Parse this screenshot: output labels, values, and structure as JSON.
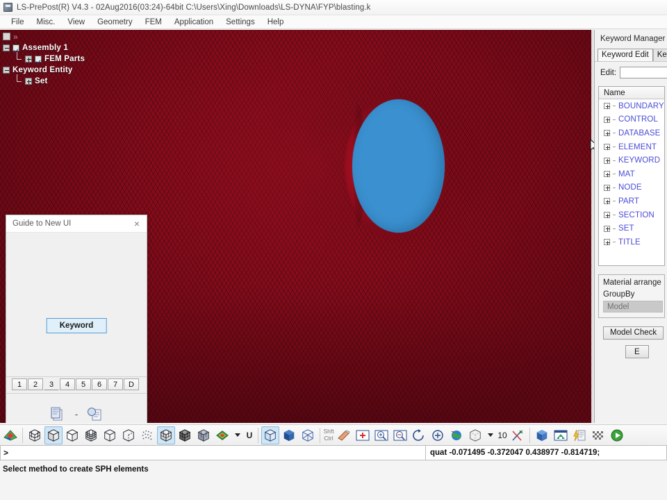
{
  "window": {
    "title": "LS-PrePost(R) V4.3 - 02Aug2016(03:24)-64bit C:\\Users\\Xing\\Downloads\\LS-DYNA\\FYP\\blasting.k",
    "app_icon": "app-icon"
  },
  "menu": {
    "items": [
      "File",
      "Misc.",
      "View",
      "Geometry",
      "FEM",
      "Application",
      "Settings",
      "Help"
    ]
  },
  "tree": {
    "nodes": [
      {
        "label": "Assembly 1",
        "expander": "minus",
        "checkbox": true,
        "indent": 0
      },
      {
        "label": "FEM Parts",
        "expander": "plus",
        "checkbox": true,
        "indent": 1
      },
      {
        "label": "Keyword Entity",
        "expander": "minus",
        "checkbox": false,
        "indent": 0
      },
      {
        "label": "Set",
        "expander": "plus",
        "checkbox": false,
        "indent": 1
      }
    ]
  },
  "guide": {
    "title": "Guide to New UI",
    "close_label": "×",
    "keyword_button": "Keyword",
    "pages": [
      "1",
      "2",
      "3",
      "4",
      "5",
      "6",
      "7",
      "D"
    ],
    "active_page": "3",
    "footer_separator": "-"
  },
  "keyword_manager": {
    "title": "Keyword Manager",
    "tabs": [
      {
        "label": "Keyword Edit",
        "active": true
      },
      {
        "label": "Key",
        "active": false
      }
    ],
    "edit_label": "Edit:",
    "edit_value": "",
    "edit_placeholder": "",
    "name_column_header": "Name",
    "keywords": [
      "BOUNDARY",
      "CONTROL",
      "DATABASE",
      "ELEMENT",
      "KEYWORD",
      "MAT",
      "NODE",
      "PART",
      "SECTION",
      "SET",
      "TITLE"
    ],
    "material_arrange_label": "Material arrange",
    "groupby_label": "GroupBy",
    "groupby_value": "Model",
    "model_check_button": "Model Check",
    "clipped_button": "E"
  },
  "toolbar": {
    "zoom_value": "10",
    "fringe_label": "U",
    "shift_label": "Shft",
    "ctrl_label": "Ctrl",
    "icons": [
      "contour-fringe-icon",
      "mesh-wireframe-icon",
      "shaded-cube-icon",
      "smooth-shade-icon",
      "mesh-grid-icon",
      "hidden-line-icon",
      "feature-line-icon",
      "particle-dots-icon",
      "shaded-mesh-icon",
      "shaded-edges-icon",
      "transparent-cube-icon",
      "color-fringe-icon",
      "solid-cube-icon",
      "filled-cube-icon",
      "wireframe-box-icon",
      "hand-pan-icon",
      "zoom-window-icon",
      "zoom-in-icon",
      "zoom-area-icon",
      "rotate-icon",
      "reset-view-icon",
      "globe-icon",
      "bounding-box-icon",
      "axis-scissors-icon",
      "part-cube-icon",
      "home-view-icon",
      "lightning-page-icon",
      "checker-icon",
      "play-button-icon"
    ]
  },
  "command": {
    "prompt": ">",
    "value": "",
    "quaternion": "quat -0.071495 -0.372047 0.438977 -0.814719;"
  },
  "status": {
    "message": "Select method to create SPH elements"
  },
  "colors": {
    "mesh_red": "#8b0d1c",
    "sphere_blue": "#3b90cf",
    "keyword_text": "#4b4bd8",
    "selected_tool": "#cfe6f7"
  }
}
